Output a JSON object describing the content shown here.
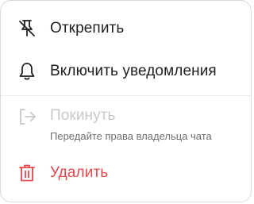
{
  "menu": {
    "items": [
      {
        "label": "Открепить",
        "icon": "unpin-icon"
      },
      {
        "label": "Включить уведомления",
        "icon": "bell-icon"
      },
      {
        "label": "Покинуть",
        "sublabel": "Передайте права владельца чата",
        "icon": "logout-icon",
        "disabled": true
      },
      {
        "label": "Удалить",
        "icon": "trash-icon",
        "destructive": true
      }
    ]
  },
  "colors": {
    "text": "#1f1f1f",
    "disabled_text": "#c9c9c9",
    "secondary_text": "#6f6f6f",
    "danger": "#e5484d",
    "border": "#d9d9d9"
  }
}
